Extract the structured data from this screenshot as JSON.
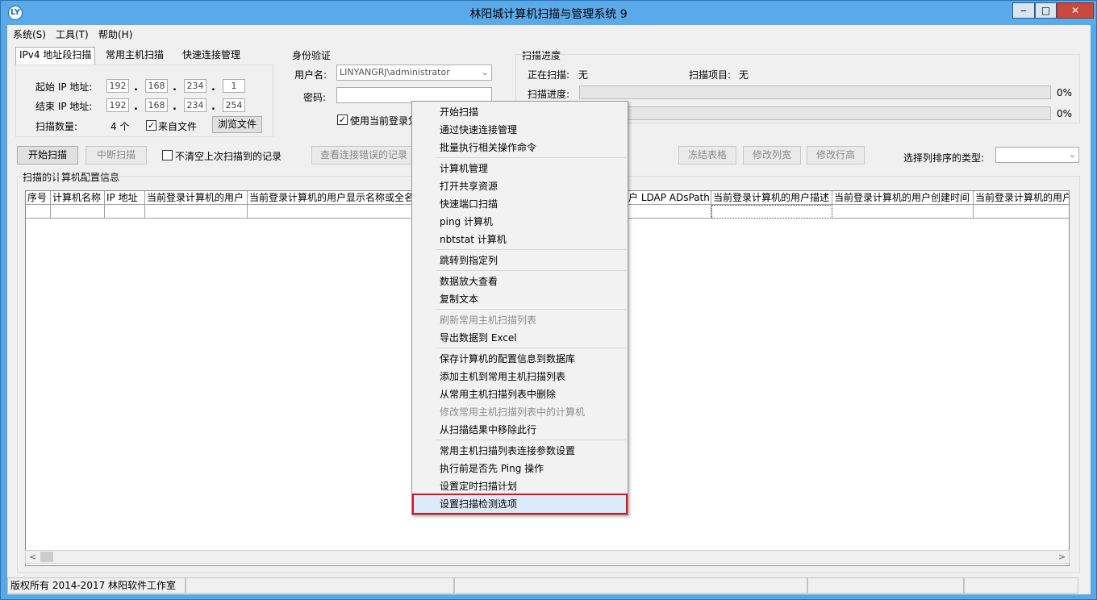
{
  "window": {
    "title": "林阳城计算机扫描与管理系统 9",
    "icon": "app-logo-icon",
    "min": "‒",
    "max": "□",
    "close": "✕"
  },
  "menu": [
    "系统(S)",
    "工具(T)",
    "帮助(H)"
  ],
  "tabs": [
    "IPv4 地址段扫描",
    "常用主机扫描",
    "快速连接管理"
  ],
  "ip_scan": {
    "start_label": "起始 IP 地址:",
    "end_label": "结束 IP 地址:",
    "start_ip": [
      "192",
      "168",
      "234",
      "1"
    ],
    "end_ip": [
      "192",
      "168",
      "234",
      "254"
    ],
    "count_label": "扫描数量:",
    "count_value": "4 个",
    "from_file_label": "来自文件",
    "from_file_checked": true,
    "browse_button": "浏览文件"
  },
  "auth": {
    "group_title": "身份验证",
    "user_label": "用户名:",
    "user_value": "LINYANGRJ\\administrator",
    "password_label": "密码:",
    "use_current_label": "使用当前登录凭"
  },
  "progress": {
    "group_title": "扫描进度",
    "scanning_label": "正在扫描:",
    "scanning_value": "无",
    "item_label": "扫描项目:",
    "item_value": "无",
    "progress_label": "扫描进度:",
    "percent1": "0%",
    "percent2": "0%"
  },
  "toolbar": {
    "start": "开始扫描",
    "stop": "中断扫描",
    "keep_label": "不清空上次扫描到的记录",
    "view_errors": "查看连接错误的记录",
    "freeze": "冻结表格",
    "col_width": "修改列宽",
    "row_height": "修改行高",
    "sort_label": "选择列排序的类型:"
  },
  "grid": {
    "title": "扫描的计算机配置信息",
    "columns": [
      "序号",
      "计算机名称",
      "IP 地址",
      "当前登录计算机的用户",
      "当前登录计算机的用户显示名称或全名",
      "户 LDAP ADsPath",
      "当前登录计算机的用户描述",
      "当前登录计算机的用户创建时间",
      "当前登录计算机的用户"
    ]
  },
  "context_menu": [
    {
      "label": "开始扫描",
      "disabled": false
    },
    {
      "label": "通过快速连接管理",
      "disabled": false
    },
    {
      "label": "批量执行相关操作命令",
      "disabled": false
    },
    {
      "sep": true
    },
    {
      "label": "计算机管理",
      "disabled": false
    },
    {
      "label": "打开共享资源",
      "disabled": false
    },
    {
      "label": "快速端口扫描",
      "disabled": false
    },
    {
      "label": "ping 计算机",
      "disabled": false
    },
    {
      "label": "nbtstat 计算机",
      "disabled": false
    },
    {
      "sep": true
    },
    {
      "label": "跳转到指定列",
      "disabled": false
    },
    {
      "sep": true
    },
    {
      "label": "数据放大查看",
      "disabled": false
    },
    {
      "label": "复制文本",
      "disabled": false
    },
    {
      "sep": true
    },
    {
      "label": "刷新常用主机扫描列表",
      "disabled": true
    },
    {
      "label": "导出数据到 Excel",
      "disabled": false
    },
    {
      "sep": true
    },
    {
      "label": "保存计算机的配置信息到数据库",
      "disabled": false
    },
    {
      "label": "添加主机到常用主机扫描列表",
      "disabled": false
    },
    {
      "label": "从常用主机扫描列表中删除",
      "disabled": false
    },
    {
      "label": "修改常用主机扫描列表中的计算机",
      "disabled": true
    },
    {
      "label": "从扫描结果中移除此行",
      "disabled": false
    },
    {
      "sep": true
    },
    {
      "label": "常用主机扫描列表连接参数设置",
      "disabled": false
    },
    {
      "label": "执行前是否先 Ping 操作",
      "disabled": false
    },
    {
      "label": "设置定时扫描计划",
      "disabled": false
    },
    {
      "label": "设置扫描检测选项",
      "disabled": false,
      "highlight": true
    }
  ],
  "status": {
    "copyright": "版权所有 2014-2017 林阳软件工作室"
  },
  "scroll": {
    "left": "<",
    "right": ">"
  }
}
